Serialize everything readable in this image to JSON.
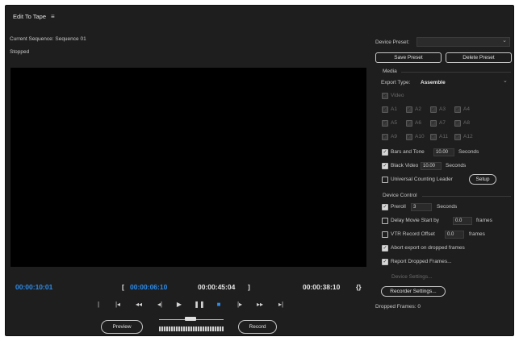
{
  "window": {
    "title": "Edit To Tape",
    "menu_icon": "menu-icon"
  },
  "sequence": {
    "current": "Current Sequence: Sequence 01",
    "status": "Stopped"
  },
  "timecodes": {
    "current": "00:00:10:01",
    "in": "00:00:06:10",
    "out": "00:00:45:04",
    "duration": "00:00:38:10",
    "in_bracket": "[",
    "out_bracket": "]",
    "duration_icon": "{}"
  },
  "transport": {
    "icons": [
      "mark-in-icon",
      "go-to-in-icon",
      "rewind-icon",
      "step-back-icon",
      "play-icon",
      "pause-icon",
      "stop-icon",
      "step-forward-icon",
      "fast-forward-icon",
      "go-to-out-icon"
    ],
    "glyphs": [
      "|",
      "|◂",
      "◂◂",
      "◂|",
      "▶",
      "❚❚",
      "■",
      "|▸",
      "▸▸",
      "▸|"
    ]
  },
  "buttons": {
    "preview": "Preview",
    "record": "Record"
  },
  "device_preset": {
    "label": "Device Preset:",
    "value": ""
  },
  "preset_buttons": {
    "save": "Save Preset",
    "delete": "Delete Preset"
  },
  "media": {
    "header": "Media",
    "export_type_label": "Export Type:",
    "export_type_value": "Assemble",
    "video_label": "Video",
    "audio_channels": [
      "A1",
      "A2",
      "A3",
      "A4",
      "A5",
      "A6",
      "A7",
      "A8",
      "A9",
      "A10",
      "A11",
      "A12"
    ],
    "bars_and_tone": {
      "label": "Bars and Tone",
      "value": "10.00",
      "unit": "Seconds"
    },
    "black_video": {
      "label": "Black Video",
      "value": "10.00",
      "unit": "Seconds"
    },
    "universal_counting_leader": {
      "label": "Universal Counting Leader",
      "setup": "Setup"
    }
  },
  "device_control": {
    "header": "Device Control",
    "preroll": {
      "label": "Preroll",
      "value": "3",
      "unit": "Seconds"
    },
    "delay_movie": {
      "label": "Delay Movie Start by",
      "value": "0.0",
      "unit": "frames"
    },
    "vtr_offset": {
      "label": "VTR Record Offset",
      "value": "0.0",
      "unit": "frames"
    },
    "abort_export": "Abort export on dropped frames",
    "report_dropped": "Report Dropped Frames...",
    "device_settings": "Device Settings...",
    "recorder_settings": "Recorder Settings..."
  },
  "dropped_frames": "Dropped Frames: 0"
}
